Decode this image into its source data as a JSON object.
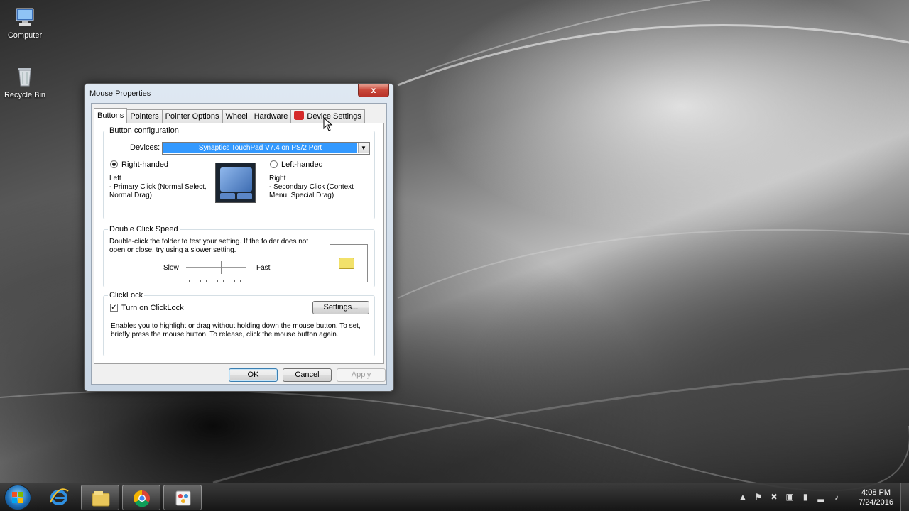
{
  "desktop": {
    "icons": [
      {
        "label": "Computer",
        "icon": "computer-icon"
      },
      {
        "label": "Recycle Bin",
        "icon": "recycle-bin-icon"
      }
    ]
  },
  "dialog": {
    "title": "Mouse Properties",
    "close_glyph": "x",
    "tabs": [
      {
        "label": "Buttons",
        "active": true
      },
      {
        "label": "Pointers"
      },
      {
        "label": "Pointer Options"
      },
      {
        "label": "Wheel"
      },
      {
        "label": "Hardware"
      },
      {
        "label": "Device Settings",
        "icon": "synaptics-icon"
      }
    ],
    "button_config": {
      "group_label": "Button configuration",
      "devices_label": "Devices:",
      "devices_value": "Synaptics TouchPad V7.4 on PS/2 Port",
      "right_handed_label": "Right-handed",
      "right_handed_selected": true,
      "left_handed_label": "Left-handed",
      "left_handed_selected": false,
      "left_title": "Left",
      "left_desc": "- Primary Click (Normal Select, Normal Drag)",
      "right_title": "Right",
      "right_desc": "- Secondary Click (Context Menu, Special Drag)"
    },
    "double_click": {
      "group_label": "Double Click Speed",
      "description": "Double-click the folder to test your setting.  If the folder does not open or close, try using a slower setting.",
      "slow_label": "Slow",
      "fast_label": "Fast",
      "speed_fraction": 0.6
    },
    "clicklock": {
      "group_label": "ClickLock",
      "checkbox_label": "Turn on ClickLock",
      "checked": true,
      "settings_button": "Settings...",
      "description": "Enables you to highlight or drag without holding down the mouse button.  To set, briefly press the mouse button.  To release, click the mouse button again."
    },
    "buttons": {
      "ok": "OK",
      "cancel": "Cancel",
      "apply": "Apply"
    }
  },
  "taskbar": {
    "pinned": [
      "internet-explorer-icon",
      "file-explorer-icon",
      "chrome-icon",
      "paint-icon"
    ],
    "tray_icons": [
      "show-hidden-icon",
      "action-center-icon",
      "network-warning-icon",
      "usb-icon",
      "power-icon",
      "signal-icon",
      "volume-icon"
    ],
    "clock_time": "4:08 PM",
    "clock_date": "7/24/2016"
  }
}
